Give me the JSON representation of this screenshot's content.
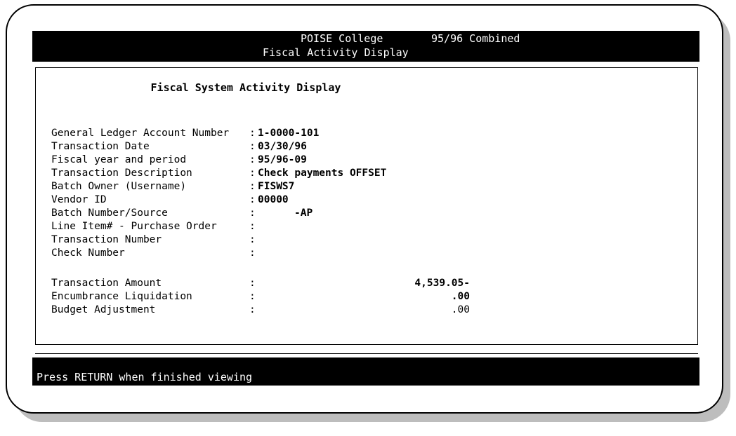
{
  "header": {
    "college": "POISE College",
    "screen_title": "Fiscal Activity Display",
    "fiscal_tag": "95/96 Combined"
  },
  "panel": {
    "title": "Fiscal System Activity Display",
    "fields": [
      {
        "label": "General Ledger Account Number",
        "value": "1-0000-101"
      },
      {
        "label": "Transaction Date",
        "value": "03/30/96"
      },
      {
        "label": "Fiscal year and period",
        "value": "95/96-09"
      },
      {
        "label": "Transaction Description",
        "value": "Check payments OFFSET"
      },
      {
        "label": "Batch Owner (Username)",
        "value": "FISWS7"
      },
      {
        "label": "Vendor ID",
        "value": "00000"
      },
      {
        "label": "Batch Number/Source",
        "value": "-AP"
      },
      {
        "label": "Line Item# - Purchase Order",
        "value": ""
      },
      {
        "label": "Transaction Number",
        "value": ""
      },
      {
        "label": "Check Number",
        "value": ""
      }
    ],
    "amounts": [
      {
        "label": "Transaction Amount",
        "value": "4,539.05-"
      },
      {
        "label": "Encumbrance Liquidation",
        "value": ".00"
      },
      {
        "label": "Budget Adjustment",
        "value": ".00"
      }
    ]
  },
  "footer": {
    "message": "Press RETURN when finished viewing"
  }
}
